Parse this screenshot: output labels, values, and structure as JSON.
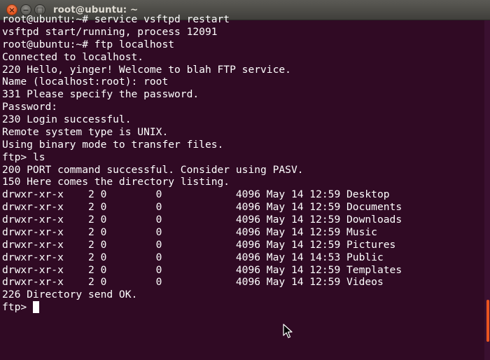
{
  "window": {
    "title": "root@ubuntu: ~",
    "close_glyph": "×",
    "minimize_glyph": "−",
    "maximize_glyph": "□"
  },
  "terminal": {
    "lines": [
      "root@ubuntu:~# service vsftpd restart",
      "vsftpd start/running, process 12091",
      "root@ubuntu:~# ftp localhost",
      "Connected to localhost.",
      "220 Hello, yinger! Welcome to blah FTP service.",
      "Name (localhost:root): root",
      "331 Please specify the password.",
      "Password:",
      "230 Login successful.",
      "Remote system type is UNIX.",
      "Using binary mode to transfer files.",
      "ftp> ls",
      "200 PORT command successful. Consider using PASV.",
      "150 Here comes the directory listing.",
      "drwxr-xr-x    2 0        0            4096 May 14 12:59 Desktop",
      "drwxr-xr-x    2 0        0            4096 May 14 12:59 Documents",
      "drwxr-xr-x    2 0        0            4096 May 14 12:59 Downloads",
      "drwxr-xr-x    2 0        0            4096 May 14 12:59 Music",
      "drwxr-xr-x    2 0        0            4096 May 14 12:59 Pictures",
      "drwxr-xr-x    2 0        0            4096 May 14 14:53 Public",
      "drwxr-xr-x    2 0        0            4096 May 14 12:59 Templates",
      "drwxr-xr-x    2 0        0            4096 May 14 12:59 Videos",
      "226 Directory send OK."
    ],
    "prompt": "ftp> "
  },
  "colors": {
    "terminal_background": "#300a24",
    "terminal_foreground": "#ffffff",
    "titlebar": "#4c4b47",
    "close_button": "#e95420",
    "scrollbar_thumb": "#e95420"
  }
}
